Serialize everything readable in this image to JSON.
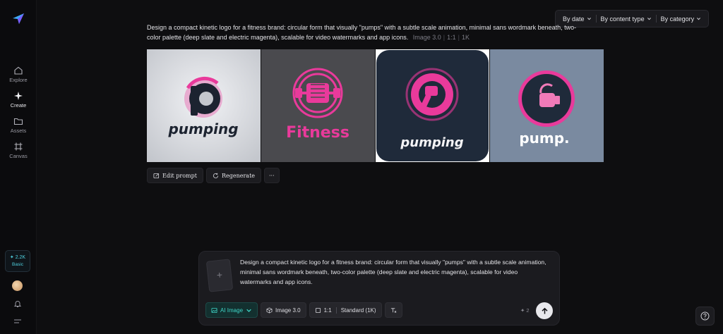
{
  "sidebar": {
    "items": [
      {
        "label": "Explore",
        "icon": "home-icon"
      },
      {
        "label": "Create",
        "icon": "sparkle-icon"
      },
      {
        "label": "Assets",
        "icon": "folder-icon"
      },
      {
        "label": "Canvas",
        "icon": "grid-icon"
      }
    ],
    "credits": {
      "amount": "✦ 2.2K",
      "plan": "Basic"
    }
  },
  "filters": {
    "by_date": "By date",
    "by_content_type": "By content type",
    "by_category": "By category"
  },
  "generation": {
    "prompt": "Design a compact kinetic logo for a fitness brand: circular form that visually \"pumps\" with a subtle scale animation, minimal sans wordmark beneath, two-color palette (deep slate and electric magenta), scalable for video watermarks and app icons.",
    "model": "Image 3.0",
    "ratio": "1:1",
    "resolution": "1K",
    "images": [
      {
        "wordmark": "pumping",
        "letter": "p"
      },
      {
        "wordmark": "Fitness"
      },
      {
        "wordmark": "pumping"
      },
      {
        "wordmark": "pump."
      }
    ],
    "actions": {
      "edit": "Edit prompt",
      "regenerate": "Regenerate",
      "more": "···"
    }
  },
  "composer": {
    "text": "Design a compact kinetic logo for a fitness brand: circular form that visually \"pumps\" with a subtle scale animation, minimal sans wordmark beneath, two-color palette (deep slate and electric magenta), scalable for video watermarks and app icons.",
    "mode": "AI Image",
    "model": "Image 3.0",
    "ratio": "1:1",
    "quality": "Standard (1K)",
    "cost": "✦ 2"
  },
  "colors": {
    "accent": "#3fd6c8",
    "magenta": "#e93a9b",
    "slate": "#1f2a3a"
  }
}
